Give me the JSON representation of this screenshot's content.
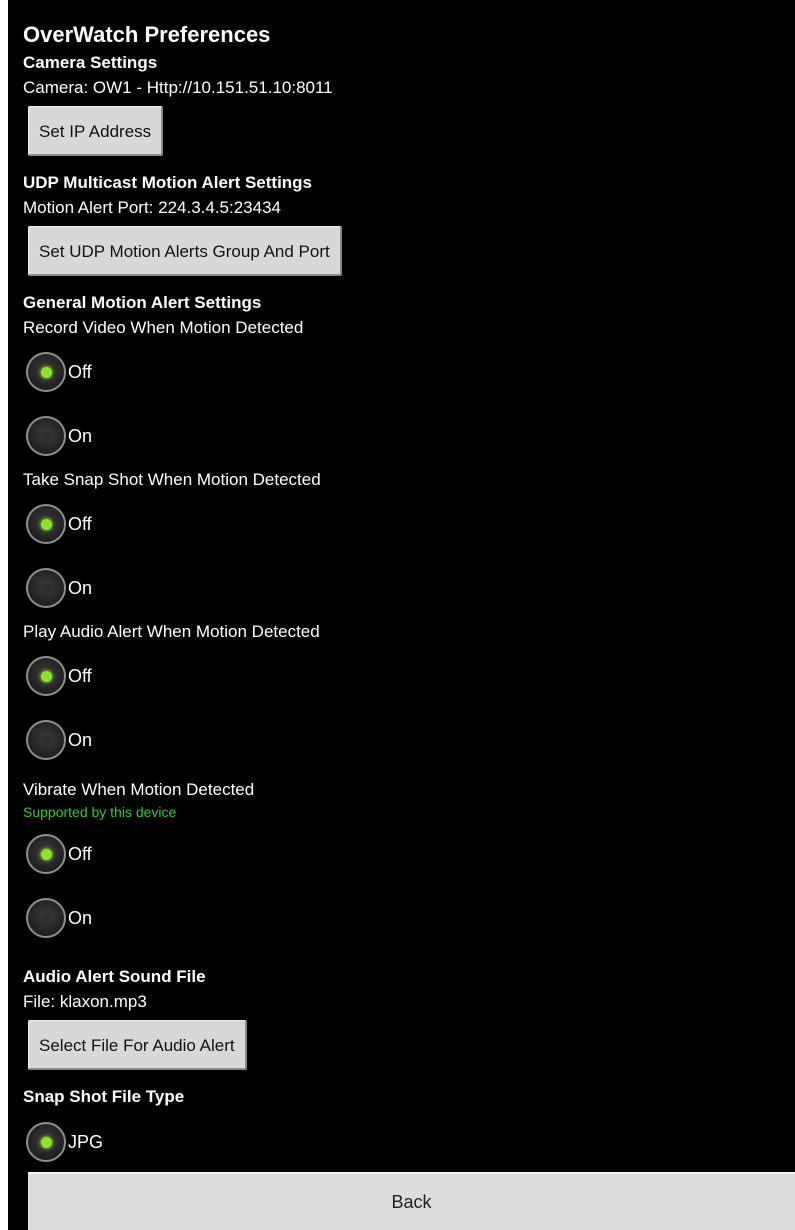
{
  "page": {
    "title": "OverWatch Preferences"
  },
  "camera": {
    "header": "Camera Settings",
    "value": "Camera: OW1 - Http://10.151.51.10:8011",
    "button": "Set IP Address"
  },
  "udp": {
    "header": "UDP Multicast Motion Alert Settings",
    "value": "Motion Alert Port: 224.3.4.5:23434",
    "button": "Set UDP Motion Alerts Group And Port"
  },
  "general": {
    "header": "General Motion Alert Settings",
    "record": {
      "label": "Record Video When Motion Detected",
      "options": [
        "Off",
        "On"
      ],
      "selected": "Off"
    },
    "snapshot": {
      "label": "Take Snap Shot When Motion Detected",
      "options": [
        "Off",
        "On"
      ],
      "selected": "Off"
    },
    "audio": {
      "label": "Play Audio Alert When Motion Detected",
      "options": [
        "Off",
        "On"
      ],
      "selected": "Off"
    },
    "vibrate": {
      "label": "Vibrate When Motion Detected",
      "note": "Supported by this device",
      "options": [
        "Off",
        "On"
      ],
      "selected": "Off"
    }
  },
  "audio_file": {
    "header": "Audio Alert Sound File",
    "value": "File: klaxon.mp3",
    "button": "Select File For Audio Alert"
  },
  "snapshot_type": {
    "header": "Snap Shot File Type",
    "first_option_partial": "JPG"
  },
  "footer": {
    "back": "Back"
  },
  "colors": {
    "background": "#000000",
    "button": "#d8d8d8",
    "radio_selected": "#8ee22f",
    "note_green": "#35c635"
  }
}
